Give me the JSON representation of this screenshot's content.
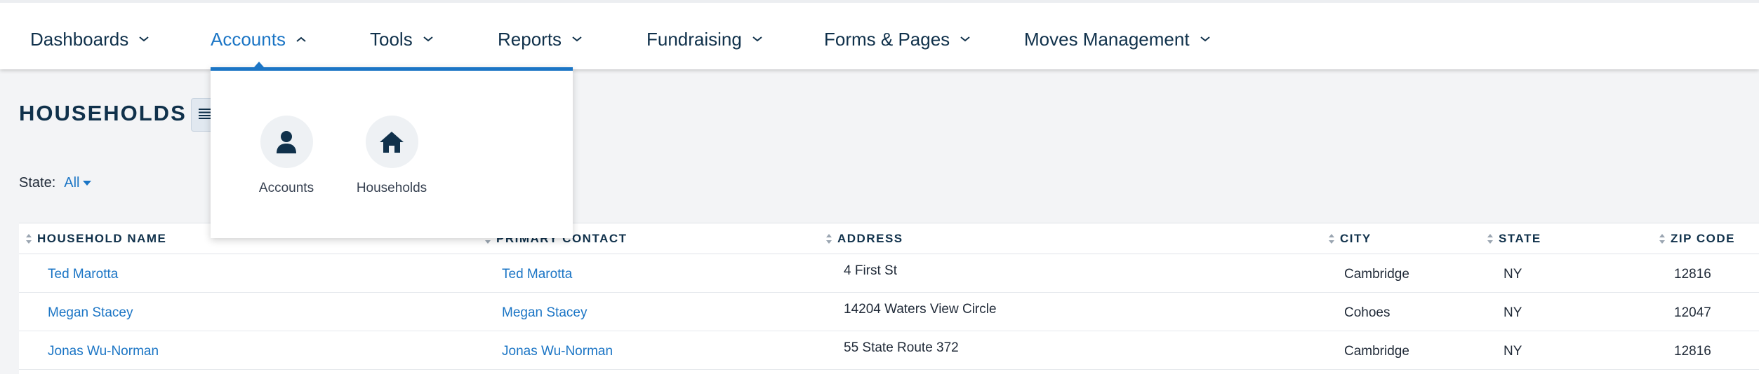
{
  "nav": {
    "items": [
      {
        "label": "Dashboards"
      },
      {
        "label": "Accounts"
      },
      {
        "label": "Tools"
      },
      {
        "label": "Reports"
      },
      {
        "label": "Fundraising"
      },
      {
        "label": "Forms & Pages"
      },
      {
        "label": "Moves Management"
      }
    ],
    "active": "Accounts"
  },
  "dropdown": {
    "items": [
      {
        "label": "Accounts",
        "icon": "person-icon"
      },
      {
        "label": "Households",
        "icon": "home-icon"
      }
    ]
  },
  "page": {
    "title": "HOUSEHOLDS",
    "view_icon": "list-icon"
  },
  "filter": {
    "label": "State:",
    "value": "All"
  },
  "table": {
    "columns": [
      "HOUSEHOLD NAME",
      "PRIMARY CONTACT",
      "ADDRESS",
      "CITY",
      "STATE",
      "ZIP CODE"
    ],
    "rows": [
      {
        "household": "Ted Marotta",
        "contact": "Ted Marotta",
        "address": "4 First St",
        "city": "Cambridge",
        "state": "NY",
        "zip": "12816"
      },
      {
        "household": "Megan Stacey",
        "contact": "Megan Stacey",
        "address": "14204 Waters View Circle",
        "city": "Cohoes",
        "state": "NY",
        "zip": "12047"
      },
      {
        "household": "Jonas Wu-Norman",
        "contact": "Jonas Wu-Norman",
        "address": "55 State Route 372",
        "city": "Cambridge",
        "state": "NY",
        "zip": "12816"
      }
    ]
  },
  "colors": {
    "accent": "#1b75c5",
    "navy": "#10314b",
    "background": "#f3f4f6"
  }
}
